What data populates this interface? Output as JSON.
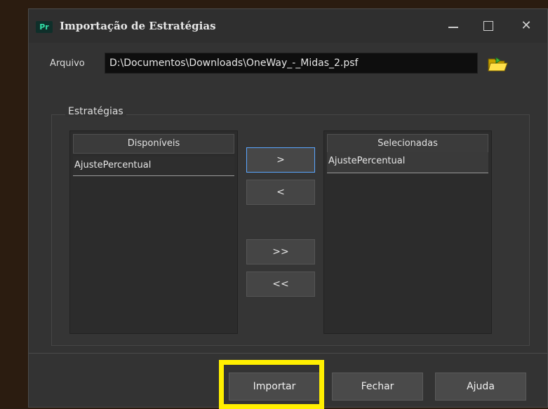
{
  "window": {
    "app_icon_text": "Pr",
    "title": "Importação de Estratégias",
    "minimize_glyph": "—",
    "maximize_glyph": "☐",
    "close_glyph": "✕"
  },
  "file": {
    "label": "Arquivo",
    "value": "D:\\Documentos\\Downloads\\OneWay_-_Midas_2.psf",
    "browse_icon": "folder-open-icon"
  },
  "strategies": {
    "group_title": "Estratégias",
    "available": {
      "header": "Disponíveis",
      "items": [
        "AjustePercentual"
      ]
    },
    "selected": {
      "header": "Selecionadas",
      "items": [
        "AjustePercentual"
      ]
    },
    "buttons": {
      "add": ">",
      "remove": "<",
      "add_all": ">>",
      "remove_all": "<<"
    }
  },
  "footer": {
    "import": "Importar",
    "close": "Fechar",
    "help": "Ajuda"
  },
  "colors": {
    "highlight": "#ffef00",
    "focus": "#5aa6ff"
  }
}
